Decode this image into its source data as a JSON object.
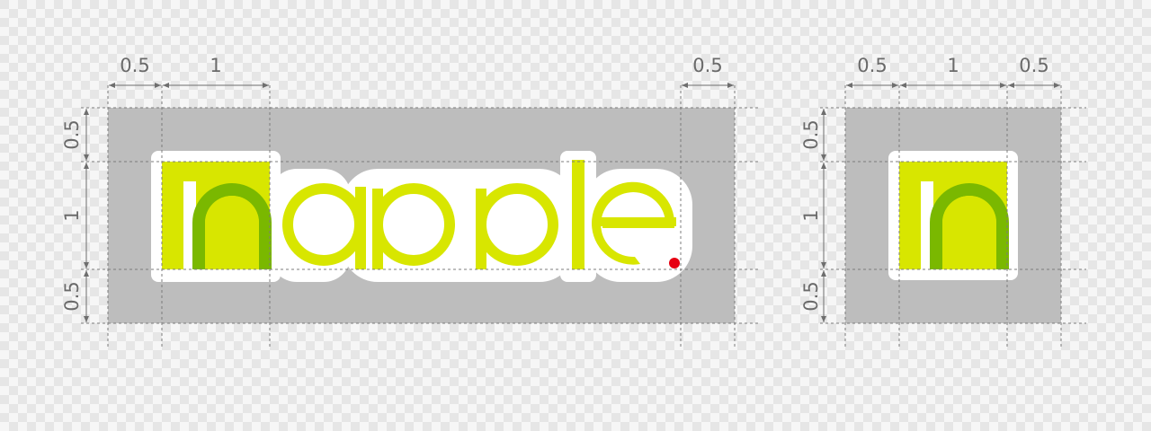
{
  "colors": {
    "clear_zone": "#bdbdbd",
    "logo_lime": "#d8e600",
    "logo_green": "#7ab800",
    "sticker_outline": "#ffffff",
    "dot_red": "#e60012",
    "dimension_line": "#6e6e6e"
  },
  "logo_full": {
    "wordmark": "napple",
    "dims": {
      "top_left_margin": "0.5",
      "top_unit": "1",
      "top_right_margin": "0.5",
      "left_top_margin": "0.5",
      "left_unit": "1",
      "left_bottom_margin": "0.5"
    }
  },
  "logo_icon": {
    "letter": "n",
    "dims": {
      "top_left_margin": "0.5",
      "top_unit": "1",
      "top_right_margin": "0.5",
      "left_top_margin": "0.5",
      "left_unit": "1",
      "left_bottom_margin": "0.5"
    }
  }
}
